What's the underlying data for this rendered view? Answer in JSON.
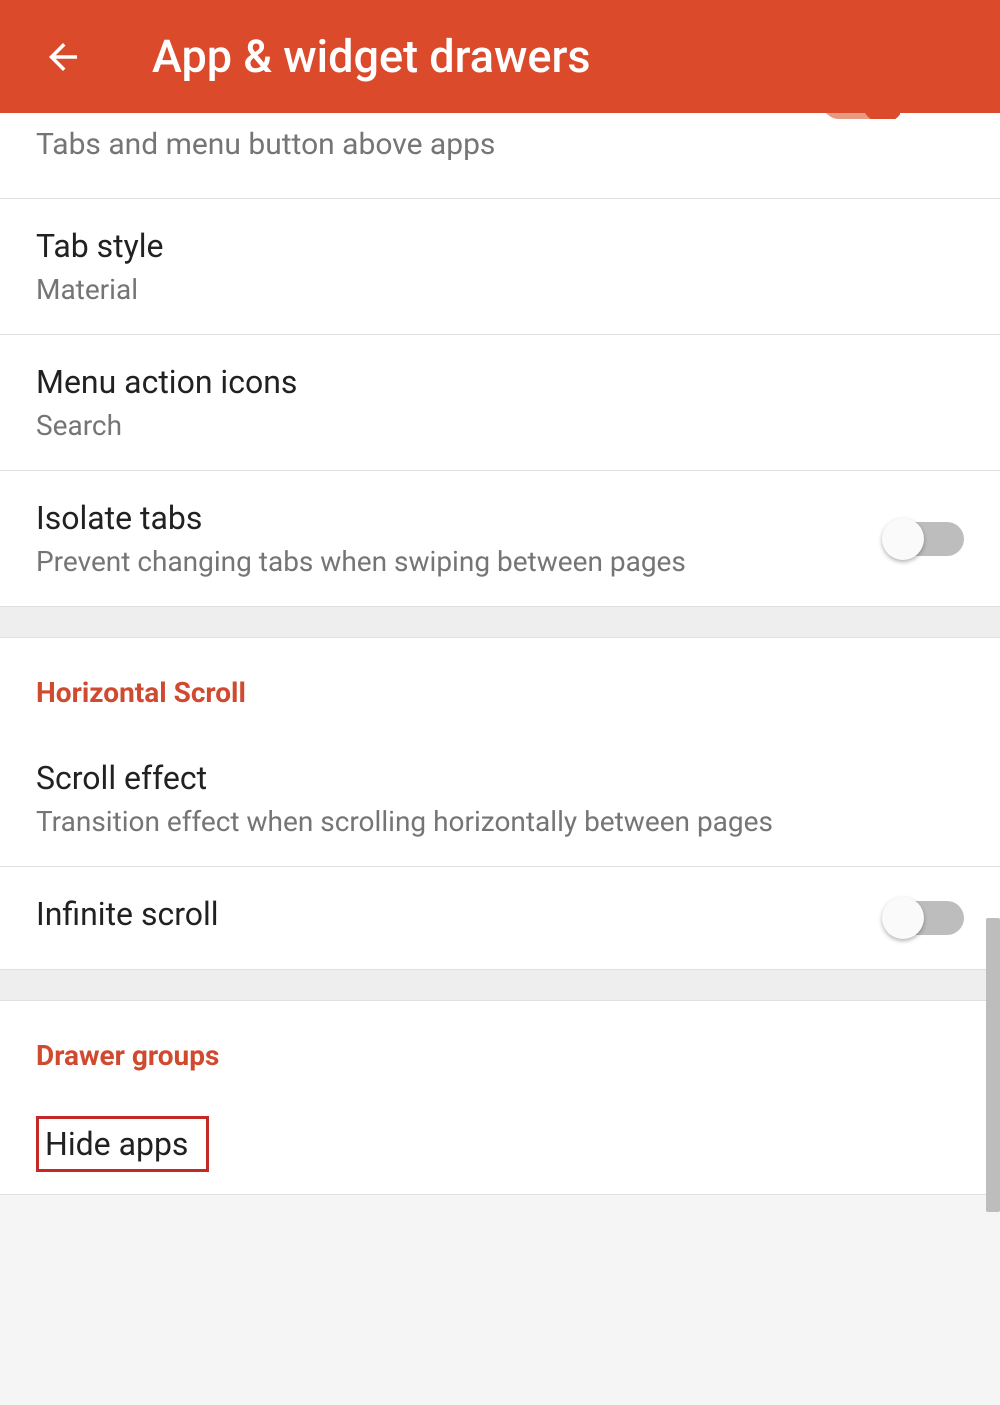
{
  "header": {
    "title": "App & widget drawers"
  },
  "settings": {
    "tabs_menu_subtitle": "Tabs and menu button above apps",
    "tab_style": {
      "title": "Tab style",
      "subtitle": "Material"
    },
    "menu_action_icons": {
      "title": "Menu action icons",
      "subtitle": "Search"
    },
    "isolate_tabs": {
      "title": "Isolate tabs",
      "subtitle": "Prevent changing tabs when swiping between pages"
    }
  },
  "sections": {
    "horizontal_scroll": {
      "header": "Horizontal Scroll",
      "scroll_effect": {
        "title": "Scroll effect",
        "subtitle": "Transition effect when scrolling horizontally between pages"
      },
      "infinite_scroll": {
        "title": "Infinite scroll"
      }
    },
    "drawer_groups": {
      "header": "Drawer groups",
      "hide_apps": {
        "title": "Hide apps"
      }
    }
  }
}
